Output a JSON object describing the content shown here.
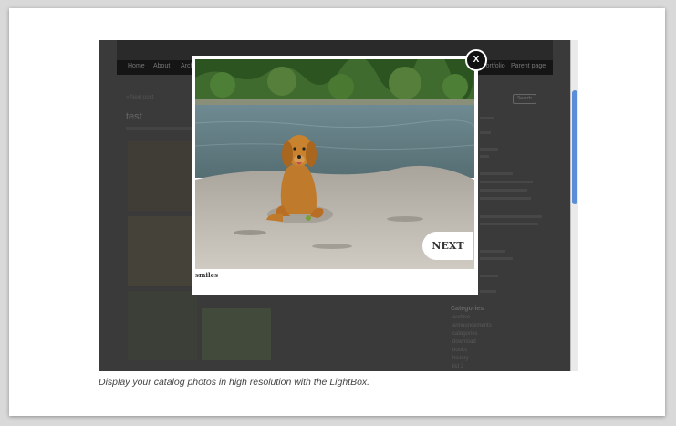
{
  "background_site": {
    "nav": [
      "Home",
      "About",
      "Archives",
      "Portfolio",
      "Parent page"
    ],
    "prev_link": "« Next post",
    "post_title": "test",
    "search_label": "Search",
    "categories_heading": "Categories",
    "categories": [
      "archive",
      "announcements",
      "categories",
      "download",
      "books",
      "history",
      "list 2"
    ]
  },
  "lightbox": {
    "caption": "smiles",
    "next_label": "NEXT",
    "close_label": "X"
  },
  "figure_caption": "Display your catalog photos in high resolution with the LightBox."
}
